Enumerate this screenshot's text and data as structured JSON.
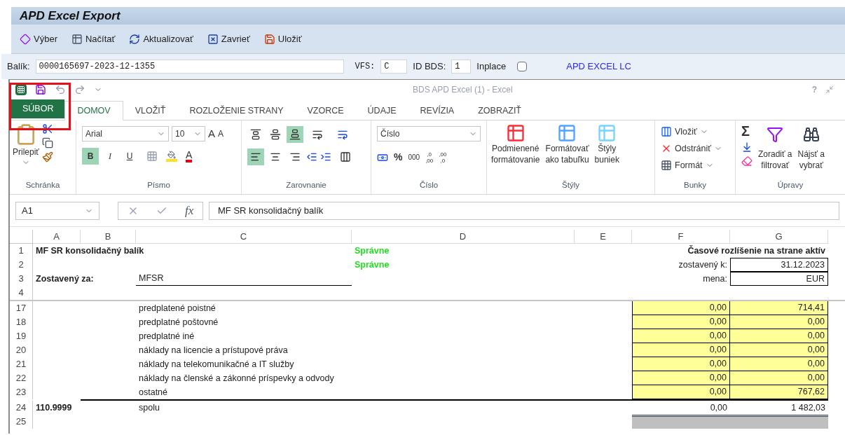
{
  "sap": {
    "title": "APD Excel Export",
    "toolbar": [
      {
        "label": "Výber",
        "kind": "select"
      },
      {
        "label": "Načítať",
        "kind": "load"
      },
      {
        "label": "Aktualizovať",
        "kind": "refresh"
      },
      {
        "label": "Zavrieť",
        "kind": "close"
      },
      {
        "label": "Uložiť",
        "kind": "save"
      }
    ],
    "package_label": "Balík:",
    "package_value": "0000165697-2023-12-1355",
    "vfs_label": "VFS:",
    "vfs_value": "C",
    "bds_label": "ID BDS:",
    "bds_value": "1",
    "inplace_label": "Inplace",
    "inplace_checked": false,
    "link": "APD EXCEL LC"
  },
  "excel": {
    "window_title": "BDS APD Excel (1) - Excel",
    "help": "?",
    "tabs": [
      {
        "label": "SÚBOR",
        "kind": "file",
        "selected": false
      },
      {
        "label": "DOMOV",
        "kind": "tab",
        "selected": true
      },
      {
        "label": "VLOŽIŤ",
        "kind": "tab",
        "selected": false
      },
      {
        "label": "ROZLOŽENIE STRANY",
        "kind": "tab",
        "selected": false
      },
      {
        "label": "VZORCE",
        "kind": "tab",
        "selected": false
      },
      {
        "label": "ÚDAJE",
        "kind": "tab",
        "selected": false
      },
      {
        "label": "REVÍZIA",
        "kind": "tab",
        "selected": false
      },
      {
        "label": "ZOBRAZIŤ",
        "kind": "tab",
        "selected": false
      }
    ],
    "ribbon": {
      "clipboard": {
        "label": "Schránka",
        "paste": "Prilepiť"
      },
      "font": {
        "label": "Písmo",
        "font": "Arial",
        "size": "10",
        "grow": "A",
        "shrink": "A",
        "bold": "B",
        "bold_on": true,
        "italic": "I",
        "italic_on": false,
        "underline": "U",
        "underline_on": false,
        "color_letter": "A"
      },
      "alignment": {
        "label": "Zarovnanie",
        "top_on": false,
        "middle_on": false,
        "bottom_on": true,
        "left_on": true,
        "center_on": false,
        "right_on": false
      },
      "number": {
        "label": "Číslo",
        "format": "Číslo",
        "percent": "%",
        "thousands": "000",
        "increase": [
          ",0",
          ",00"
        ],
        "decrease": [
          ",00",
          ",0"
        ]
      },
      "styles": {
        "label": "Štýly",
        "buttons": [
          {
            "lines": [
              "Podmienené",
              "formátovanie"
            ],
            "kind": "conditional"
          },
          {
            "lines": [
              "Formátovať",
              "ako tabuľku"
            ],
            "kind": "table"
          },
          {
            "lines": [
              "Štýly",
              "buniek"
            ],
            "kind": "cell"
          }
        ]
      },
      "cells": {
        "label": "Bunky",
        "buttons": [
          {
            "label": "Vložiť",
            "kind": "insert"
          },
          {
            "label": "Odstrániť",
            "kind": "delete"
          },
          {
            "label": "Formát",
            "kind": "format"
          }
        ]
      },
      "editing": {
        "label": "Úpravy",
        "sum": "Σ",
        "sort": [
          "Zoradiť a",
          "filtrovať"
        ],
        "find": [
          "Nájsť a",
          "vybrať"
        ]
      }
    },
    "name_box": "A1",
    "function_symbol": "fx",
    "formula": "MF SR konsolidačný balík",
    "columns": [
      "A",
      "B",
      "C",
      "D",
      "E",
      "F",
      "G"
    ],
    "rows": [
      {
        "number": "1",
        "a": {
          "text": "MF SR konsolidačný balík",
          "kind": "bold"
        },
        "d": {
          "text": "Správne",
          "kind": "ok"
        },
        "e": {
          "text": "Časové rozlíšenie na strane aktív",
          "kind": "heading"
        }
      },
      {
        "number": "2",
        "d": {
          "text": "Správne",
          "kind": "ok"
        },
        "f": {
          "text": "zostavený k:",
          "kind": "label"
        },
        "g": {
          "text": "31.12.2023",
          "kind": "boxed"
        }
      },
      {
        "number": "3",
        "a": {
          "text": "Zostavený za:",
          "kind": "bold"
        },
        "c": {
          "text": "MFSR",
          "kind": "underlined"
        },
        "f": {
          "text": "mena:",
          "kind": "label"
        },
        "g": {
          "text": "EUR",
          "kind": "boxed"
        }
      },
      {
        "number": "4",
        "split_after": true
      },
      {
        "number": "17",
        "c": {
          "text": "predplatené poistné",
          "kind": "text"
        },
        "f": {
          "text": "0,00",
          "kind": "input"
        },
        "g": {
          "text": "714,41",
          "kind": "input"
        }
      },
      {
        "number": "18",
        "c": {
          "text": "predplatné poštovné",
          "kind": "text"
        },
        "f": {
          "text": "0,00",
          "kind": "input"
        },
        "g": {
          "text": "0,00",
          "kind": "input"
        }
      },
      {
        "number": "19",
        "c": {
          "text": "predplatné iné",
          "kind": "text"
        },
        "f": {
          "text": "0,00",
          "kind": "input"
        },
        "g": {
          "text": "0,00",
          "kind": "input"
        }
      },
      {
        "number": "20",
        "c": {
          "text": "náklady na licencie a prístupové práva",
          "kind": "text"
        },
        "f": {
          "text": "0,00",
          "kind": "input"
        },
        "g": {
          "text": "0,00",
          "kind": "input"
        }
      },
      {
        "number": "21",
        "c": {
          "text": "náklady na telekomunikačné a IT služby",
          "kind": "text"
        },
        "f": {
          "text": "0,00",
          "kind": "input"
        },
        "g": {
          "text": "0,00",
          "kind": "input"
        }
      },
      {
        "number": "22",
        "c": {
          "text": "náklady na členské a zákonné príspevky a odvody",
          "kind": "text"
        },
        "f": {
          "text": "0,00",
          "kind": "input"
        },
        "g": {
          "text": "0,00",
          "kind": "input"
        }
      },
      {
        "number": "23",
        "c": {
          "text": "ostatné",
          "kind": "text"
        },
        "f": {
          "text": "0,00",
          "kind": "input"
        },
        "g": {
          "text": "767,62",
          "kind": "input"
        }
      },
      {
        "number": "24",
        "total_line": true,
        "a": {
          "text": "110.9999",
          "kind": "bold"
        },
        "c": {
          "text": "spolu",
          "kind": "text"
        },
        "f": {
          "text": "0,00",
          "kind": "number"
        },
        "g": {
          "text": "1 482,03",
          "kind": "number"
        }
      },
      {
        "number": "25",
        "f": {
          "kind": "shaded"
        },
        "g": {
          "kind": "shaded"
        }
      }
    ]
  },
  "highlight": true
}
